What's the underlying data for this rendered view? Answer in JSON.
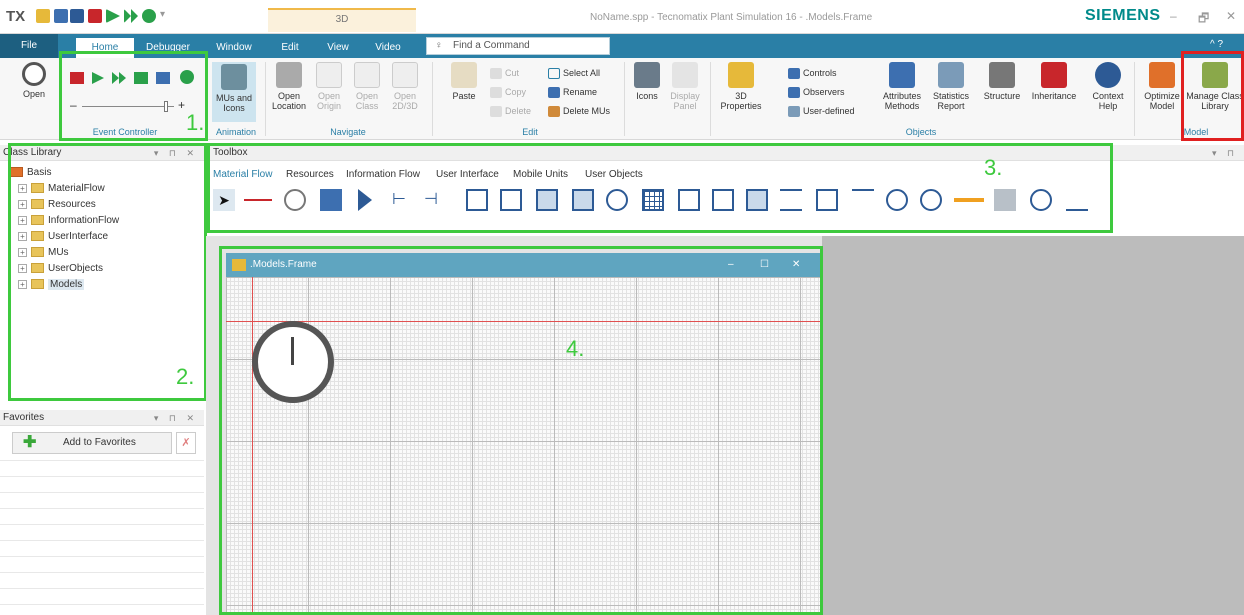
{
  "titlebar": {
    "app_logo": "TX",
    "context_tab": "3D",
    "window_title": "NoName.spp - Tecnomatix Plant Simulation 16 - .Models.Frame",
    "brand": "SIEMENS",
    "controls": {
      "minimize": "–",
      "restore": "🗗",
      "close": "✕"
    }
  },
  "ribbon_tabs": [
    "File",
    "Home",
    "Debugger",
    "Window",
    "Edit",
    "View",
    "Video"
  ],
  "active_tab": "Home",
  "find_command": {
    "placeholder": "Find a Command"
  },
  "ribbon": {
    "open": "Open",
    "event_controller_group": "Event Controller",
    "animation": {
      "button": "MUs and Icons",
      "group": "Animation"
    },
    "navigate": {
      "open_location": "Open Location",
      "open_origin": "Open Origin",
      "open_class": "Open Class",
      "open_2d3d": "Open 2D/3D",
      "group": "Navigate"
    },
    "edit": {
      "paste": "Paste",
      "cut": "Cut",
      "copy": "Copy",
      "delete": "Delete",
      "select_all": "Select All",
      "rename": "Rename",
      "delete_mus": "Delete MUs",
      "group": "Edit"
    },
    "icons": "Icons",
    "display_panel": "Display Panel",
    "objects": {
      "properties_3d": "3D Properties",
      "controls": "Controls",
      "observers": "Observers",
      "user_defined": "User-defined",
      "attributes_methods": "Attributes Methods",
      "statistics_report": "Statistics Report",
      "structure": "Structure",
      "inheritance": "Inheritance",
      "context_help": "Context Help",
      "group": "Objects"
    },
    "model": {
      "optimize_model": "Optimize Model",
      "manage_class_library": "Manage Class Library",
      "group": "Model"
    }
  },
  "class_library": {
    "title": "Class Library",
    "root": "Basis",
    "items": [
      "MaterialFlow",
      "Resources",
      "InformationFlow",
      "UserInterface",
      "MUs",
      "UserObjects",
      "Models"
    ]
  },
  "favorites": {
    "title": "Favorites",
    "add_button": "Add to Favorites"
  },
  "toolbox": {
    "title": "Toolbox",
    "tabs": [
      "Material Flow",
      "Resources",
      "Information Flow",
      "User Interface",
      "Mobile Units",
      "User Objects"
    ],
    "active_tab": "Material Flow"
  },
  "frame_window": {
    "title": ".Models.Frame"
  },
  "annotations": [
    "1.",
    "2.",
    "3.",
    "4."
  ],
  "colors": {
    "ribbon_blue": "#2a7fa6",
    "highlight_green": "#3ec93e",
    "highlight_red": "#e02020",
    "siemens": "#008a8a"
  }
}
